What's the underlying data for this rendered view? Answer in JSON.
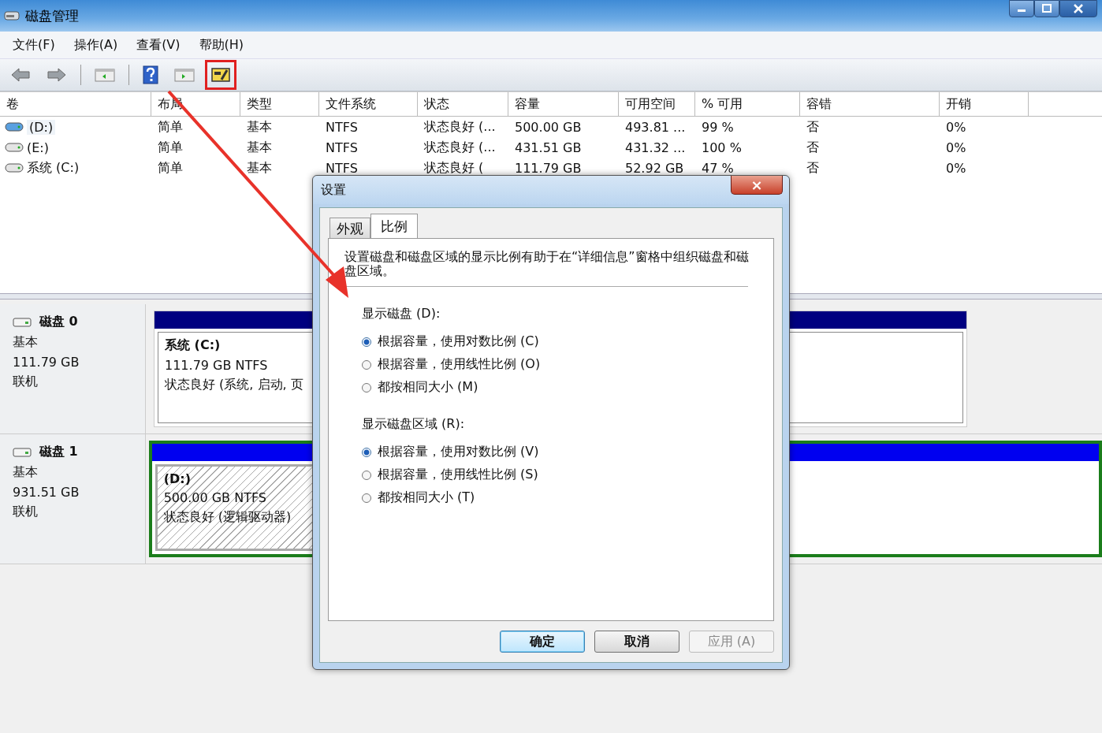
{
  "window": {
    "title": "磁盘管理"
  },
  "menu": [
    "文件(F)",
    "操作(A)",
    "查看(V)",
    "帮助(H)"
  ],
  "toolbar": [
    {
      "kind": "back",
      "highlighted": false
    },
    {
      "kind": "forward",
      "highlighted": false
    },
    {
      "kind": "separator"
    },
    {
      "kind": "tree",
      "highlighted": false
    },
    {
      "kind": "separator"
    },
    {
      "kind": "help",
      "highlighted": false
    },
    {
      "kind": "pane",
      "highlighted": false
    },
    {
      "kind": "properties",
      "highlighted": true
    }
  ],
  "volumes": {
    "columns": [
      "卷",
      "布局",
      "类型",
      "文件系统",
      "状态",
      "容量",
      "可用空间",
      "% 可用",
      "容错",
      "开销"
    ],
    "rows": [
      {
        "selected": true,
        "cells": [
          "(D:)",
          "简单",
          "基本",
          "NTFS",
          "状态良好 (...",
          "500.00 GB",
          "493.81 ...",
          "99 %",
          "否",
          "0%"
        ]
      },
      {
        "selected": false,
        "cells": [
          "(E:)",
          "简单",
          "基本",
          "NTFS",
          "状态良好 (...",
          "431.51 GB",
          "431.32 ...",
          "100 %",
          "否",
          "0%"
        ]
      },
      {
        "selected": false,
        "cells": [
          "系统 (C:)",
          "简单",
          "基本",
          "NTFS",
          "状态良好 (",
          "111.79 GB",
          "52.92 GB",
          "47 %",
          "否",
          "0%"
        ]
      }
    ]
  },
  "disks": [
    {
      "name": "磁盘 0",
      "type": "基本",
      "size": "111.79 GB",
      "status": "联机",
      "selected": false,
      "partitions": [
        {
          "kind": "primary",
          "name": "系统 (C:)",
          "size": "111.79 GB NTFS",
          "status": "状态良好 (系统, 启动, 页"
        }
      ]
    },
    {
      "name": "磁盘 1",
      "type": "基本",
      "size": "931.51 GB",
      "status": "联机",
      "selected": true,
      "partitions": [
        {
          "kind": "logical",
          "name": "(D:)",
          "size": "500.00 GB NTFS",
          "status": "状态良好 (逻辑驱动器)"
        }
      ]
    }
  ],
  "dialog": {
    "title": "设置",
    "close": "×",
    "tabs": [
      {
        "label": "外观",
        "selected": false
      },
      {
        "label": "比例",
        "selected": true
      }
    ],
    "description": "设置磁盘和磁盘区域的显示比例有助于在“详细信息”窗格中组织磁盘和磁盘区域。",
    "groups": [
      {
        "label": "显示磁盘 (D):",
        "options": [
          {
            "label": "根据容量，使用对数比例 (C)",
            "selected": true
          },
          {
            "label": "根据容量，使用线性比例 (O)",
            "selected": false
          },
          {
            "label": "都按相同大小 (M)",
            "selected": false
          }
        ]
      },
      {
        "label": "显示磁盘区域 (R):",
        "options": [
          {
            "label": "根据容量，使用对数比例 (V)",
            "selected": true
          },
          {
            "label": "根据容量，使用线性比例 (S)",
            "selected": false
          },
          {
            "label": "都按相同大小 (T)",
            "selected": false
          }
        ]
      }
    ],
    "buttons": [
      {
        "label": "确定",
        "default": true,
        "disabled": false
      },
      {
        "label": "取消",
        "default": false,
        "disabled": false
      },
      {
        "label": "应用 (A)",
        "default": false,
        "disabled": true
      }
    ]
  }
}
